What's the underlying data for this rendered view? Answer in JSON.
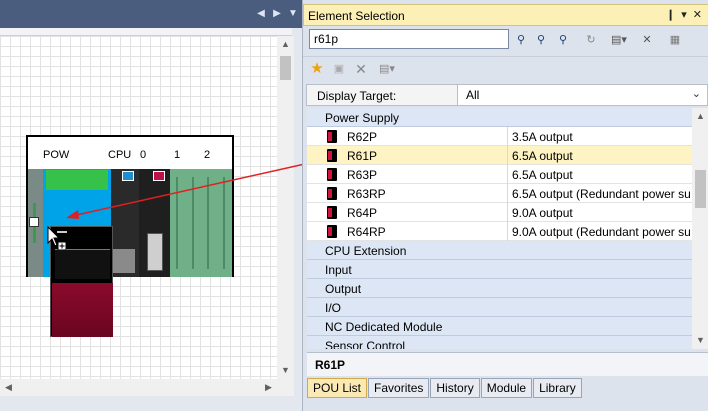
{
  "editor": {
    "base_labels": [
      "POW",
      "CPU",
      "0",
      "1",
      "2"
    ]
  },
  "panel": {
    "title": "Element Selection",
    "title_buttons": [
      "❙",
      "▾",
      "✕"
    ],
    "search_value": "r61p",
    "display_target_label": "Display Target:",
    "display_target_value": "All",
    "categories": {
      "power_supply": "Power Supply",
      "cpu_extension": "CPU Extension",
      "input": "Input",
      "output": "Output",
      "io": "I/O",
      "nc_module": "NC Dedicated Module",
      "sensor_control": "Sensor Control"
    },
    "power_items": [
      {
        "name": "R62P",
        "desc": "3.5A output"
      },
      {
        "name": "R61P",
        "desc": "6.5A output"
      },
      {
        "name": "R63P",
        "desc": "6.5A output"
      },
      {
        "name": "R63RP",
        "desc": "6.5A output (Redundant power su"
      },
      {
        "name": "R64P",
        "desc": "9.0A output"
      },
      {
        "name": "R64RP",
        "desc": "9.0A output (Redundant power su"
      }
    ],
    "selected_name": "R61P",
    "tabs": [
      "POU List",
      "Favorites",
      "History",
      "Module",
      "Library"
    ],
    "active_tab": "POU List"
  },
  "colors": {
    "selection_highlight": "#fdf3c3",
    "title_bar": "#fdf0b6",
    "drag_arrow": "#e02020"
  }
}
